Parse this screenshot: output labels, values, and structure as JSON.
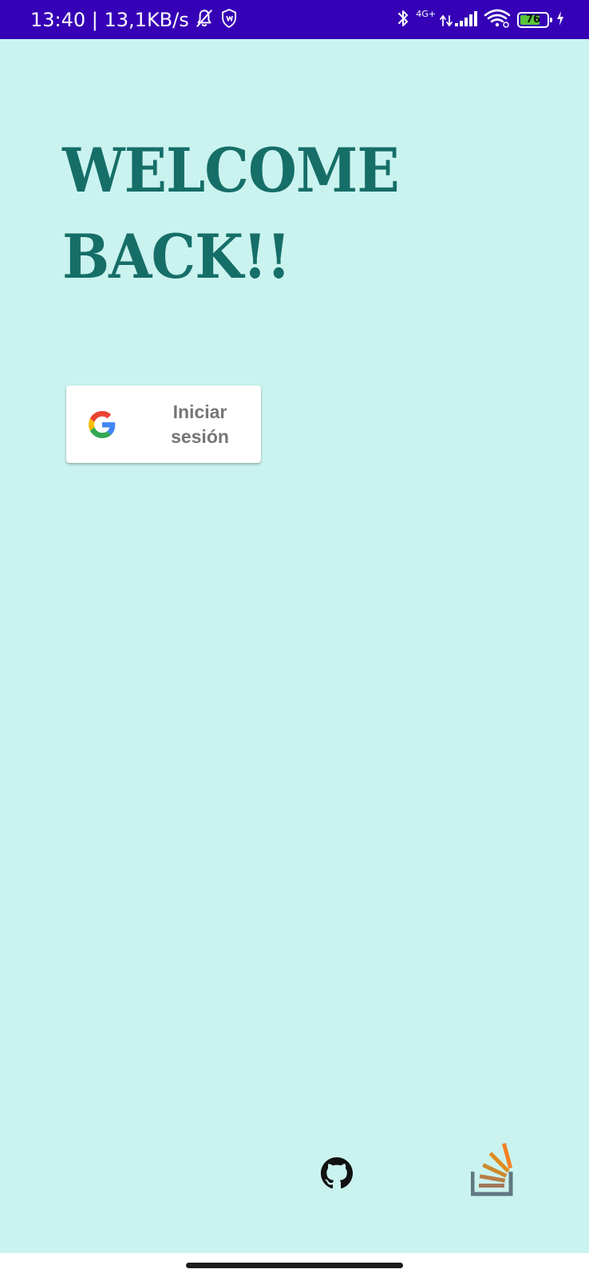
{
  "status_bar": {
    "time_and_speed": "13:40 | 13,1KB/s",
    "network_type": "4G+",
    "battery_level": "76",
    "battery_fraction": 0.76,
    "background_color": "#3600b6",
    "icons": [
      "bell-off-icon",
      "shield-icon",
      "bluetooth-icon",
      "signal-icon",
      "wifi-icon",
      "battery-icon",
      "charging-icon"
    ]
  },
  "main": {
    "title_line1": "WELCOME",
    "title_line2": "BACK!!",
    "title_color": "#166e68",
    "background_color": "#caf3ef"
  },
  "google_button": {
    "label": "Iniciar sesión",
    "icon": "google-logo-icon"
  },
  "footer_links": [
    {
      "icon": "github-icon"
    },
    {
      "icon": "stackoverflow-icon"
    }
  ]
}
